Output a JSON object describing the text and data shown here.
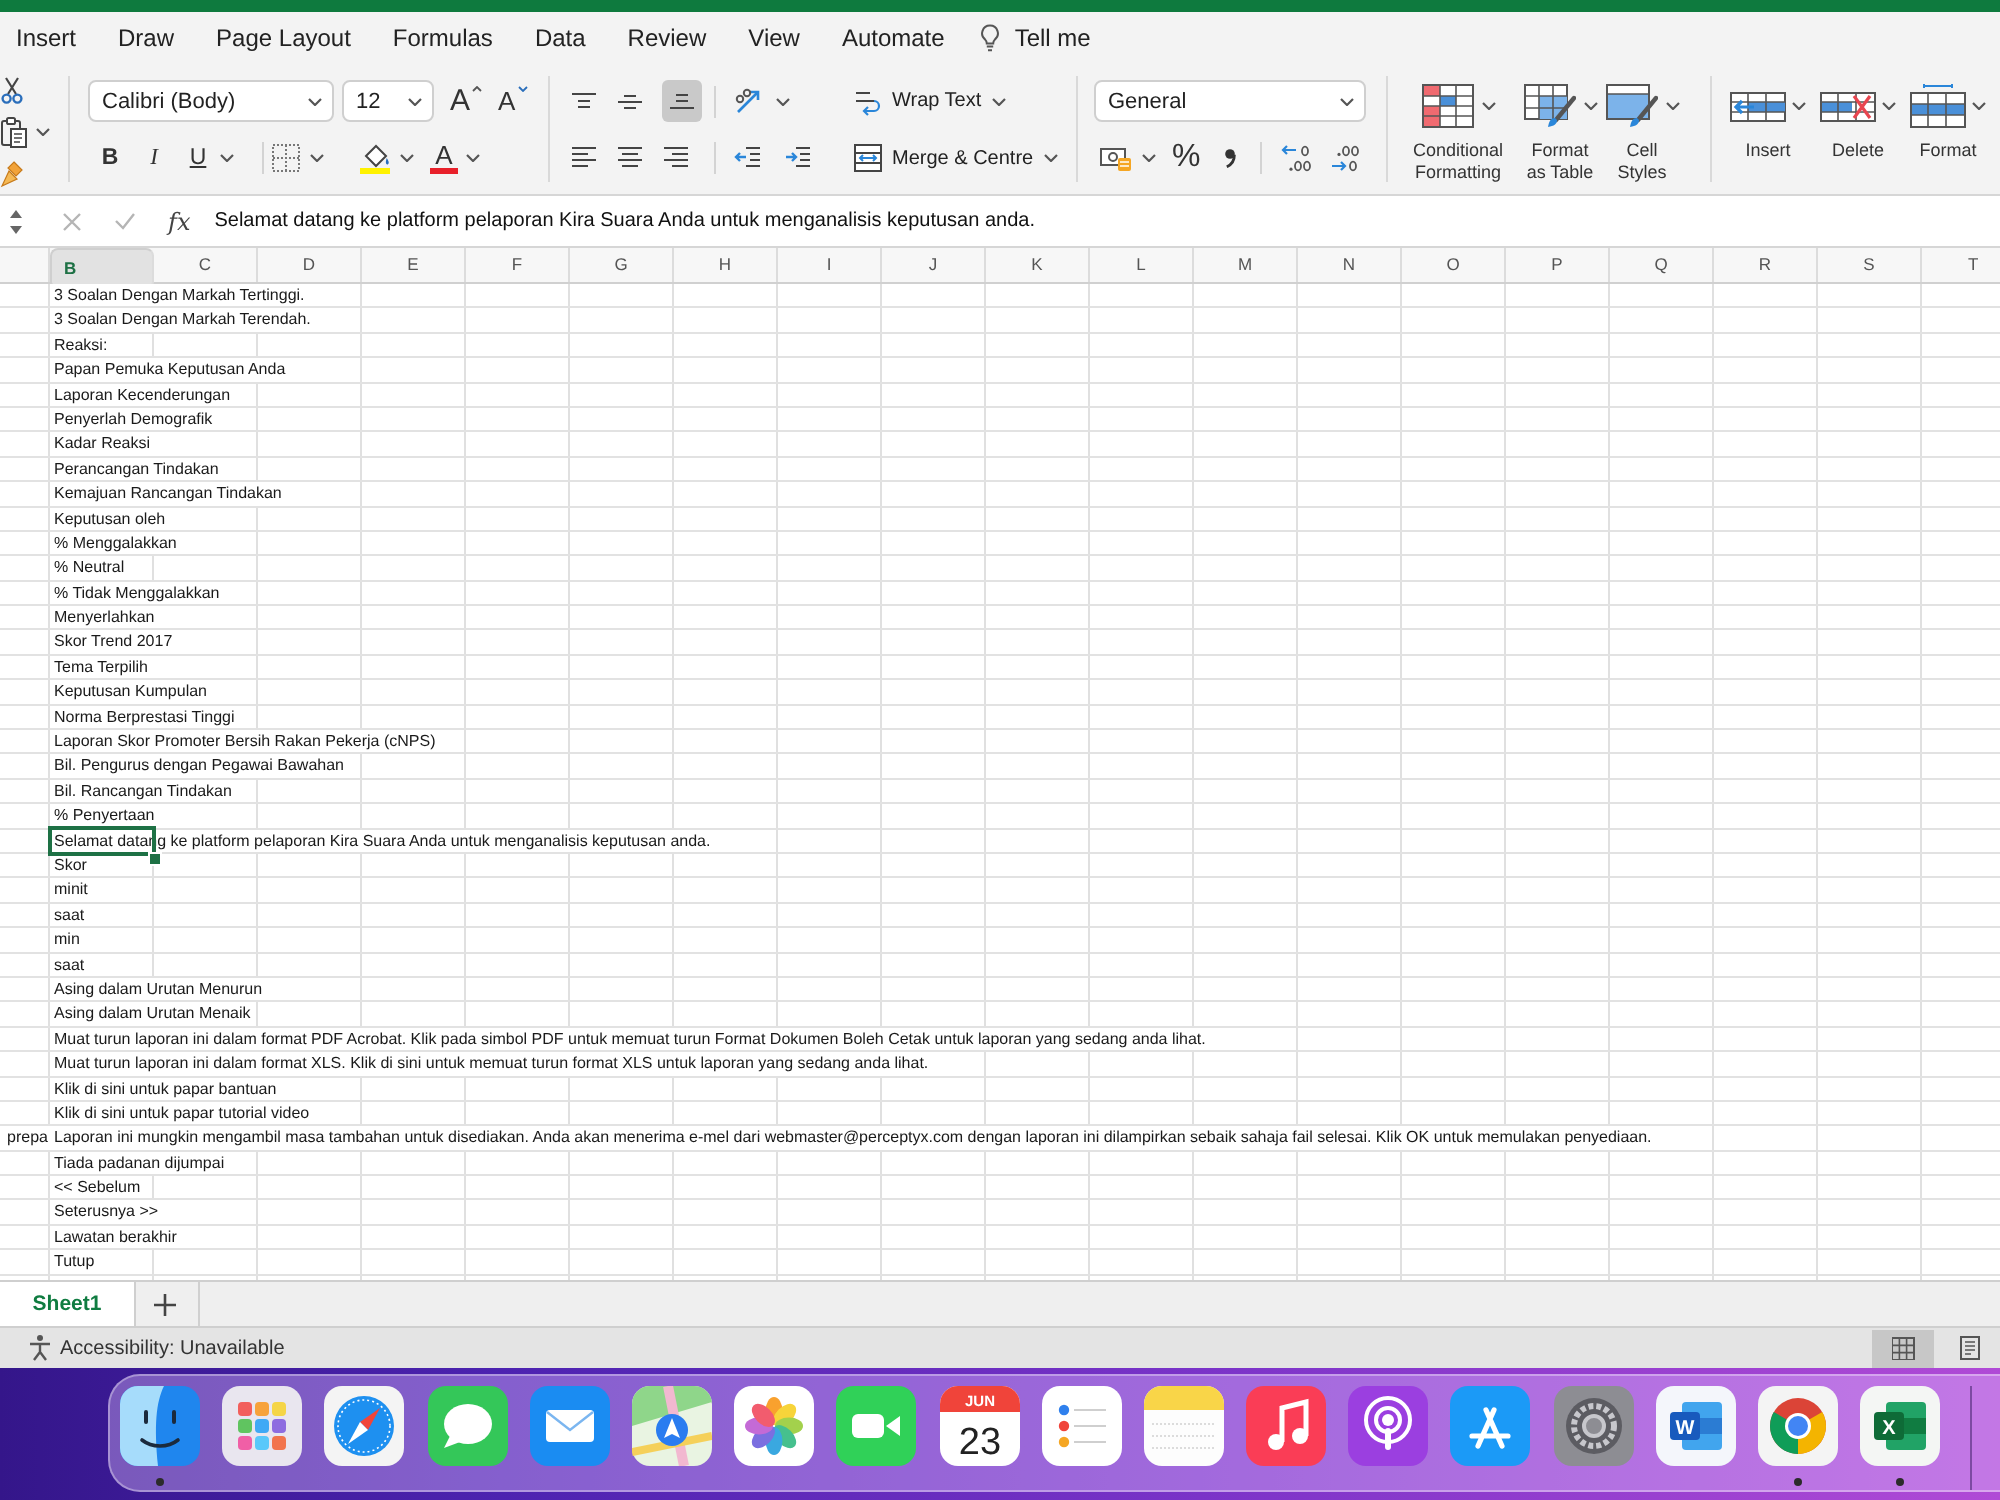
{
  "ribbon_tabs": [
    "Insert",
    "Draw",
    "Page Layout",
    "Formulas",
    "Data",
    "Review",
    "View",
    "Automate"
  ],
  "tell_me": "Tell me",
  "ribbon": {
    "font_name": "Calibri (Body)",
    "font_size": "12",
    "font_size_buttons": [
      "A",
      "A"
    ],
    "font_style_buttons": [
      "B",
      "I",
      "U"
    ],
    "font_color_button": "A",
    "vertical_alignment": [
      {
        "selected": false
      },
      {
        "selected": false
      },
      {
        "selected": true
      }
    ],
    "wrap_text": "Wrap Text",
    "merge": "Merge & Centre",
    "number_format": "General",
    "percent": "%",
    "styles": [
      "Conditional Formatting",
      "Format as Table",
      "Cell Styles"
    ],
    "cells": [
      "Insert",
      "Delete",
      "Format"
    ]
  },
  "formula_bar": {
    "function_label": "fx",
    "formula": "Selamat datang ke platform pelaporan Kira Suara Anda untuk menganalisis keputusan anda."
  },
  "columns": [
    {
      "label": "B",
      "selected": true
    },
    {
      "label": "C",
      "selected": false
    },
    {
      "label": "D",
      "selected": false
    },
    {
      "label": "E",
      "selected": false
    },
    {
      "label": "F",
      "selected": false
    },
    {
      "label": "G",
      "selected": false
    },
    {
      "label": "H",
      "selected": false
    },
    {
      "label": "I",
      "selected": false
    },
    {
      "label": "J",
      "selected": false
    },
    {
      "label": "K",
      "selected": false
    },
    {
      "label": "L",
      "selected": false
    },
    {
      "label": "M",
      "selected": false
    },
    {
      "label": "N",
      "selected": false
    },
    {
      "label": "O",
      "selected": false
    },
    {
      "label": "P",
      "selected": false
    },
    {
      "label": "Q",
      "selected": false
    },
    {
      "label": "R",
      "selected": false
    },
    {
      "label": "S",
      "selected": false
    },
    {
      "label": "T",
      "selected": false
    }
  ],
  "rows": [
    {
      "column_b": "3 Soalan Dengan Markah Tertinggi.",
      "selected": false
    },
    {
      "column_b": "3 Soalan Dengan Markah Terendah.",
      "selected": false
    },
    {
      "column_b": "Reaksi:",
      "selected": false
    },
    {
      "column_b": "Papan Pemuka Keputusan Anda",
      "selected": false
    },
    {
      "column_b": "Laporan Kecenderungan",
      "selected": false
    },
    {
      "column_b": "Penyerlah Demografik",
      "selected": false
    },
    {
      "column_b": "Kadar Reaksi",
      "selected": false
    },
    {
      "column_b": "Perancangan Tindakan",
      "selected": false
    },
    {
      "column_b": "Kemajuan Rancangan Tindakan",
      "selected": false
    },
    {
      "column_b": "Keputusan oleh",
      "selected": false
    },
    {
      "column_b": "% Menggalakkan",
      "selected": false
    },
    {
      "column_b": "% Neutral",
      "selected": false
    },
    {
      "column_b": "% Tidak Menggalakkan",
      "selected": false
    },
    {
      "column_b": "Menyerlahkan",
      "selected": false
    },
    {
      "column_b": "Skor Trend 2017",
      "selected": false
    },
    {
      "column_b": "Tema Terpilih",
      "selected": false
    },
    {
      "column_b": "Keputusan Kumpulan",
      "selected": false
    },
    {
      "column_b": "Norma Berprestasi Tinggi",
      "selected": false
    },
    {
      "column_b": "Laporan Skor Promoter Bersih Rakan Pekerja (cNPS)",
      "selected": false
    },
    {
      "column_b": "Bil. Pengurus dengan Pegawai Bawahan",
      "selected": false
    },
    {
      "column_b": "Bil. Rancangan Tindakan",
      "selected": false
    },
    {
      "column_b": "% Penyertaan",
      "selected": false
    },
    {
      "column_b": "Selamat datang ke platform pelaporan Kira Suara Anda untuk menganalisis keputusan anda.",
      "selected": true
    },
    {
      "column_b": "Skor",
      "selected": false
    },
    {
      "column_b": "minit",
      "selected": false
    },
    {
      "column_b": "saat",
      "selected": false
    },
    {
      "column_b": "min",
      "selected": false
    },
    {
      "column_b": "saat",
      "selected": false
    },
    {
      "column_b": "Asing dalam Urutan Menurun",
      "selected": false
    },
    {
      "column_b": "Asing dalam Urutan Menaik",
      "selected": false
    },
    {
      "column_b": "Muat turun laporan ini dalam format PDF Acrobat. Klik pada simbol PDF untuk memuat turun Format Dokumen Boleh Cetak untuk laporan yang sedang anda lihat.",
      "selected": false
    },
    {
      "column_b": "Muat turun laporan ini dalam format XLS. Klik di sini untuk memuat turun format XLS untuk laporan yang sedang anda lihat.",
      "selected": false
    },
    {
      "column_b": "Klik di sini untuk papar bantuan",
      "selected": false
    },
    {
      "column_b": "Klik di sini untuk papar tutorial video",
      "selected": false
    },
    {
      "column_a": "prepa",
      "column_b": "Laporan ini mungkin mengambil masa tambahan untuk disediakan. Anda akan menerima e-mel dari webmaster@perceptyx.com dengan laporan ini dilampirkan sebaik sahaja fail selesai. Klik OK untuk memulakan penyediaan.",
      "selected": false
    },
    {
      "column_b": "Tiada padanan dijumpai",
      "selected": false
    },
    {
      "column_b": "<< Sebelum",
      "selected": false
    },
    {
      "column_b": "Seterusnya >>",
      "selected": false
    },
    {
      "column_b": "Lawatan berakhir",
      "selected": false
    },
    {
      "column_b": "Tutup",
      "selected": false
    }
  ],
  "sheet_tabs": [
    {
      "label": "Sheet1",
      "selected": true
    }
  ],
  "status_bar": {
    "text": "Accessibility: Unavailable",
    "view_buttons": [
      {
        "selected": true
      },
      {
        "selected": false
      }
    ]
  },
  "dock": [
    {
      "kind": "finder",
      "running": true
    },
    {
      "kind": "launchpad",
      "running": false
    },
    {
      "kind": "safari",
      "running": false
    },
    {
      "kind": "messages",
      "running": false
    },
    {
      "kind": "mail",
      "running": false
    },
    {
      "kind": "maps",
      "running": false
    },
    {
      "kind": "photos",
      "running": false
    },
    {
      "kind": "facetime",
      "running": false
    },
    {
      "kind": "calendar",
      "month": "JUN",
      "day": "23",
      "running": false
    },
    {
      "kind": "reminders",
      "running": false
    },
    {
      "kind": "notes",
      "running": false
    },
    {
      "kind": "music",
      "running": false
    },
    {
      "kind": "podcasts",
      "running": false
    },
    {
      "kind": "appstore",
      "running": false
    },
    {
      "kind": "settings",
      "running": false
    },
    {
      "kind": "word",
      "letter": "W",
      "running": false
    },
    {
      "kind": "chrome",
      "running": true
    },
    {
      "kind": "excel",
      "letter": "X",
      "running": true
    }
  ]
}
